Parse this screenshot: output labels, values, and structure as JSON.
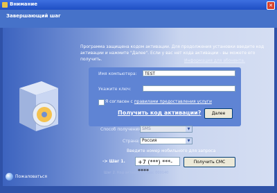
{
  "window": {
    "title": "Внимание",
    "close_symbol": "✕"
  },
  "banner": {
    "title": "Завершающий шаг"
  },
  "intro": {
    "line1": "Программа защищена кодом активации.  Для продолжения установки введите код",
    "line2": "активации и нажмите \"Далее\". Если у вас нет кода активации - вы можете его получить.",
    "info_link": "Информация для абонента."
  },
  "form": {
    "computer_name_label": "Имя компьютера:",
    "computer_name_value": "TEST",
    "key_label": "Укажите ключ:",
    "key_value": "",
    "agree_prefix": "Я согласен с ",
    "agree_link": "правилами предоставления услуги",
    "get_code_link": "Получить код активации?",
    "next_button": "Далее"
  },
  "request": {
    "method_label": "Способ получения:",
    "method_value": "SMS",
    "country_label": "Страна:",
    "country_value": "Россия",
    "phone_prompt": "Введите номер мобильного для запроса",
    "step_label": "-> Шаг 1.",
    "phone_value": "+7 (***) ***-****",
    "send_button": "Получить СМС",
    "step2_hint": "Шаг 2. Код активации ваш: 000140"
  },
  "footer": {
    "report_label": "Пожаловаться"
  },
  "colors": {
    "accent": "#2f52a8",
    "titlebar": "#1f4fc4",
    "button_bg": "#ece9d8"
  }
}
